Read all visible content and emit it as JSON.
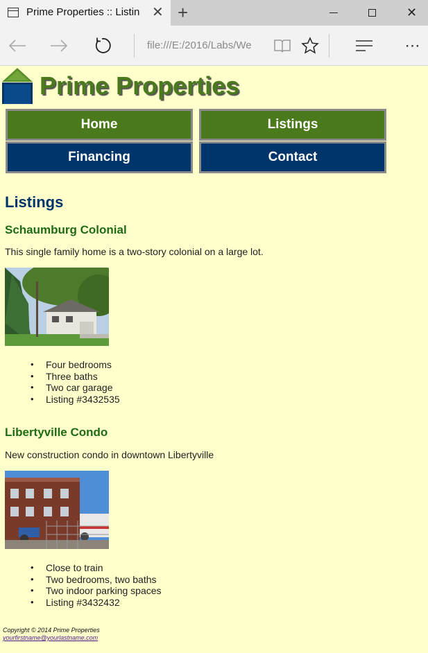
{
  "browser": {
    "tab_title": "Prime Properties :: Listin",
    "address": "file:///E:/2016/Labs/We",
    "icons": [
      "tab-page-icon",
      "close-icon",
      "new-tab-icon",
      "minimize-icon",
      "maximize-icon",
      "close-window-icon",
      "back-arrow-icon",
      "forward-arrow-icon",
      "refresh-icon",
      "reading-view-icon",
      "favorite-star-icon",
      "hub-icon",
      "more-icon"
    ]
  },
  "site": {
    "title": "Prime Properties",
    "logo_icon": "house-logo-icon",
    "colors": {
      "background": "#ffffcc",
      "green": "#4a7a1b",
      "navy": "#00356b",
      "heading_green": "#1f6b16"
    }
  },
  "menu": {
    "home": "Home",
    "listings": "Listings",
    "financing": "Financing",
    "contact": "Contact"
  },
  "main": {
    "heading": "Listings",
    "properties": [
      {
        "title": "Schaumburg Colonial",
        "description": "This single family home is a two-story colonial on a large lot.",
        "photo_icon": "colonial-house-photo",
        "features": [
          "Four bedrooms",
          "Three baths",
          "Two car garage",
          "Listing #3432535"
        ]
      },
      {
        "title": "Libertyville Condo",
        "description": "New construction condo in downtown Libertyville",
        "photo_icon": "condo-building-photo",
        "features": [
          "Close to train",
          "Two bedrooms, two baths",
          "Two indoor parking spaces",
          "Listing #3432432"
        ]
      }
    ]
  },
  "footer": {
    "copyright": "Copyright © 2014 Prime Properties",
    "email": "yourfirstname@yourlastname.com"
  }
}
